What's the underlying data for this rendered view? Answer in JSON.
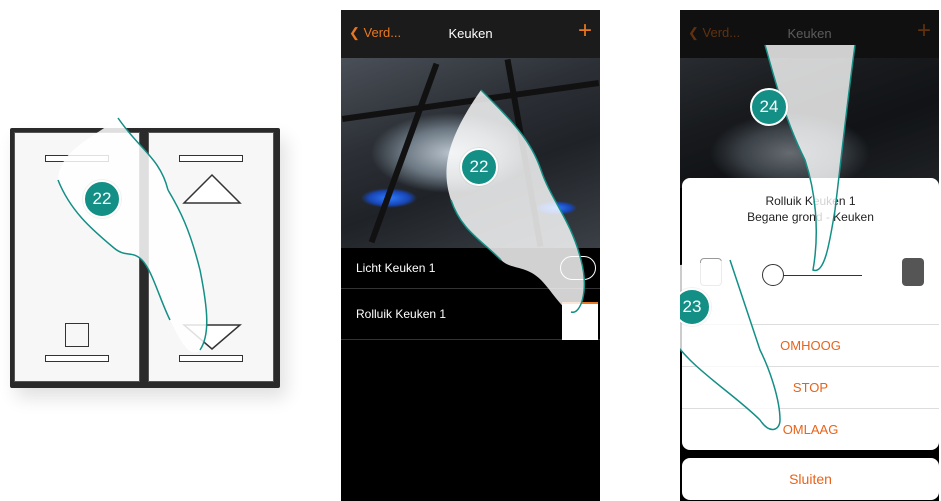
{
  "steps": {
    "switch": "22",
    "phone1": "22",
    "phone2_slider": "24",
    "phone2_actions": "23"
  },
  "phone1": {
    "back_label": "Verd...",
    "title": "Keuken",
    "plus_icon": "+",
    "rows": [
      {
        "label": "Licht Keuken 1"
      },
      {
        "label": "Rolluik Keuken 1"
      }
    ]
  },
  "phone2": {
    "back_label": "Verd...",
    "title": "Keuken",
    "plus_icon": "+",
    "device_name": "Rolluik Keuken 1",
    "device_location": "Begane grond - Keuken",
    "actions": [
      "OMHOOG",
      "STOP",
      "OMLAAG"
    ],
    "close_label": "Sluiten"
  },
  "colors": {
    "accent": "#e87722",
    "step_bubble": "#138f86",
    "topbar": "#1b1b1b"
  }
}
